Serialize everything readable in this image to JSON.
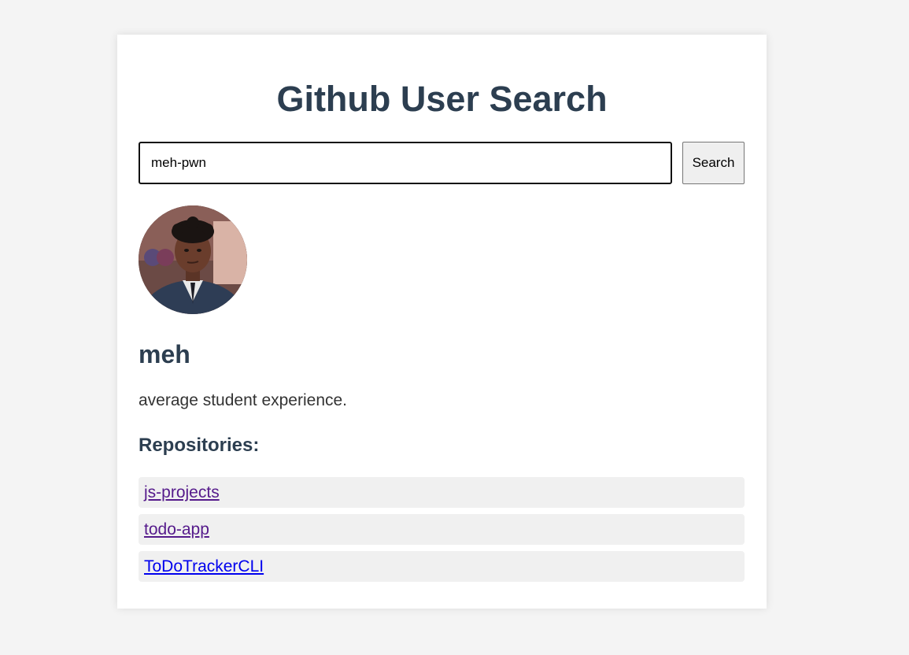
{
  "header": {
    "title": "Github User Search"
  },
  "search": {
    "value": "meh-pwn",
    "button_label": "Search"
  },
  "profile": {
    "name": "meh",
    "bio": "average student experience."
  },
  "repositories": {
    "heading": "Repositories:",
    "items": [
      {
        "name": "js-projects",
        "visited": true
      },
      {
        "name": "todo-app",
        "visited": true
      },
      {
        "name": "ToDoTrackerCLI",
        "visited": false
      }
    ]
  },
  "colors": {
    "page_background": "#f4f4f4",
    "card_background": "#ffffff",
    "heading": "#2c3e50",
    "link": "#0000ee",
    "visited_link": "#551a8b",
    "repo_item_background": "#f0f0f0"
  }
}
